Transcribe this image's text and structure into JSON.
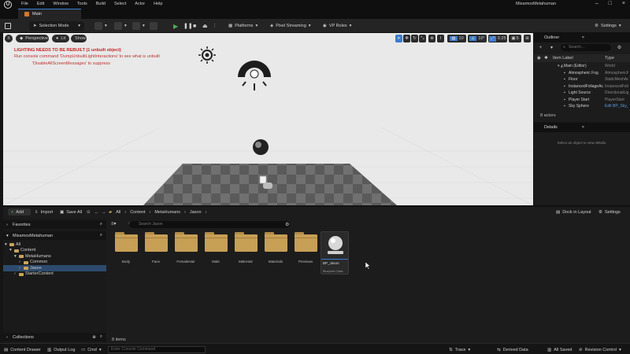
{
  "menu": [
    "File",
    "Edit",
    "Window",
    "Tools",
    "Build",
    "Select",
    "Actor",
    "Help"
  ],
  "project_name": "MixamoxMetahuman",
  "tab_label": "Main",
  "toolbar": {
    "selection_mode": "Selection Mode",
    "platforms": "Platforms",
    "pixel_streaming": "Pixel Streaming",
    "vp_roles": "VP Roles",
    "settings": "Settings"
  },
  "viewport": {
    "perspective": "Perspective",
    "lit": "Lit",
    "show": "Show",
    "warning": "LIGHTING NEEDS TO BE REBUILT (1 unbuilt object)",
    "console_hint": "Run console command 'DumpUnbuiltLightInteractions' to see what is unbuilt",
    "suppress_hint": "'DisableAllScreenMessages' to suppress",
    "grid_snap": "10",
    "rot_snap": "10°",
    "scale_snap": "0.25",
    "camera_speed": "5"
  },
  "outliner": {
    "title": "Outliner",
    "search_placeholder": "Search...",
    "col_label": "Item Label",
    "col_type": "Type",
    "rows": [
      {
        "label": "Main (Editor)",
        "type": "World"
      },
      {
        "label": "Atmospheric Fog",
        "type": "AtmosphericFog"
      },
      {
        "label": "Floor",
        "type": "StaticMeshActor"
      },
      {
        "label": "InstancedFoliageActor",
        "type": "InstancedFoliageActor"
      },
      {
        "label": "Light Source",
        "type": "DirectionalLight"
      },
      {
        "label": "Player Start",
        "type": "PlayerStart"
      },
      {
        "label": "Sky Sphere",
        "type": "Edit BP_Sky_Sphere"
      }
    ],
    "actor_count": "8 actors"
  },
  "details": {
    "title": "Details",
    "empty": "Select an object to view details."
  },
  "content_browser": {
    "add": "Add",
    "import": "Import",
    "save_all": "Save All",
    "path": [
      "All",
      "Content",
      "MetaHumans",
      "Jason"
    ],
    "dock": "Dock in Layout",
    "settings": "Settings",
    "search_placeholder": "Search Jason",
    "favorites": "Favorites",
    "project": "MixamoxMetahuman",
    "collections": "Collections",
    "tree": [
      {
        "label": "All",
        "indent": 0
      },
      {
        "label": "Content",
        "indent": 1
      },
      {
        "label": "MetaHumans",
        "indent": 2
      },
      {
        "label": "Common",
        "indent": 3
      },
      {
        "label": "Jason",
        "indent": 3
      },
      {
        "label": "StarterContent",
        "indent": 2
      }
    ],
    "folders": [
      "Body",
      "Face",
      "FemaleHair",
      "Male",
      "MaleHair",
      "Materials",
      "Previews"
    ],
    "asset": {
      "name": "BP_Jason",
      "type": "Blueprint Class"
    },
    "items_count": "8 items"
  },
  "statusbar": {
    "content_drawer": "Content Drawer",
    "output_log": "Output Log",
    "cmd": "Cmd",
    "console_placeholder": "Enter Console Command",
    "trace": "Trace",
    "derived_data": "Derived Data",
    "all_saved": "All Saved",
    "revision_control": "Revision Control"
  }
}
